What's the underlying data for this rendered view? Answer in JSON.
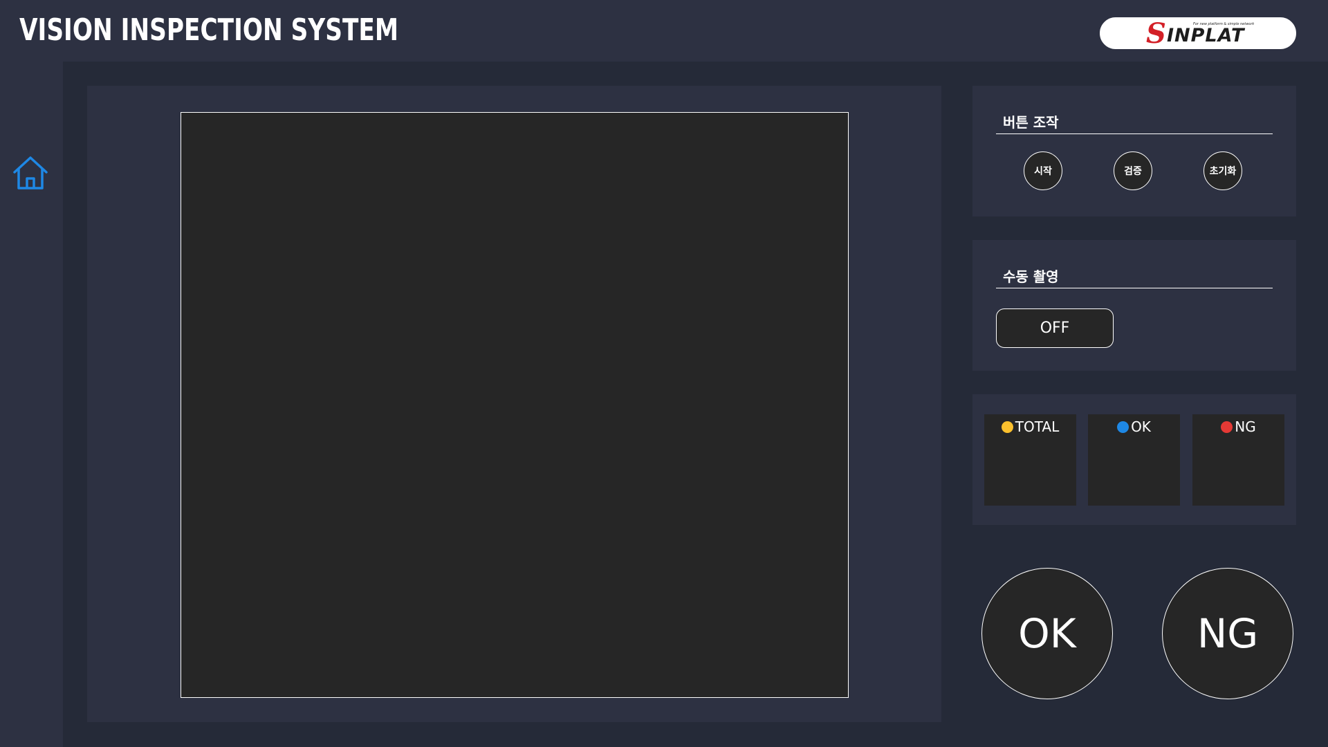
{
  "header": {
    "title": "VISION INSPECTION SYSTEM",
    "logo": {
      "initial": "S",
      "word": "INPLAT",
      "tagline": "For new platform & simple network"
    }
  },
  "sidebar": {
    "home_icon": "home-icon"
  },
  "controls": {
    "heading": "버튼 조작",
    "start_label": "시작",
    "verify_label": "검증",
    "reset_label": "초기화"
  },
  "manual_capture": {
    "heading": "수동 촬영",
    "toggle_label": "OFF"
  },
  "stats": {
    "total_label": "TOTAL",
    "ok_label": "OK",
    "ng_label": "NG",
    "total_value": "",
    "ok_value": "",
    "ng_value": ""
  },
  "result": {
    "ok_label": "OK",
    "ng_label": "NG"
  },
  "colors": {
    "background": "#2d3142",
    "content_background": "#252a38",
    "panel_dark": "#262626",
    "accent_blue": "#1e88e5",
    "total_dot": "#fbc02d",
    "ok_dot": "#1e88e5",
    "ng_dot": "#e53935",
    "logo_red": "#d32027"
  }
}
